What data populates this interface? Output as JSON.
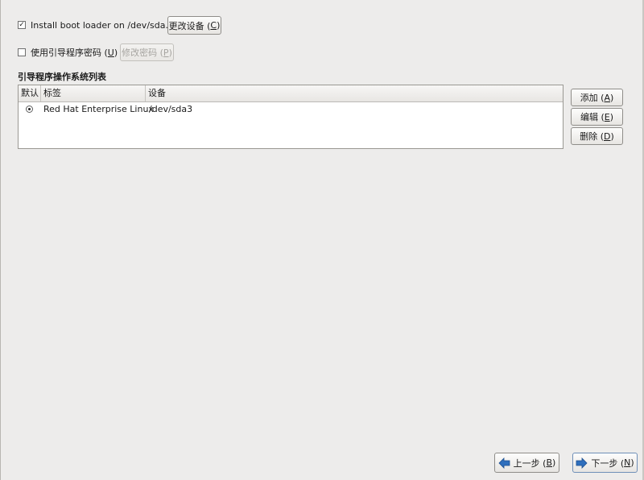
{
  "bootloader": {
    "install_label": "Install boot loader on /dev/sda.",
    "install_checked": true,
    "change_device_button": {
      "text": "更改设备 (",
      "mnemonic": "C",
      "close": ")"
    }
  },
  "password": {
    "label": "使用引导程序密码 (",
    "mnemonic": "U",
    "close": ")",
    "checked": false,
    "change_password_button": {
      "text": "修改密码 (",
      "mnemonic": "P",
      "close": ")"
    }
  },
  "os_list": {
    "title": "引导程序操作系统列表",
    "columns": [
      "默认",
      "标签",
      "设备"
    ],
    "rows": [
      {
        "default": true,
        "label": "Red Hat Enterprise Linux",
        "device": "/dev/sda3"
      }
    ]
  },
  "side_buttons": {
    "add": {
      "text": "添加 (",
      "mnemonic": "A",
      "close": ")"
    },
    "edit": {
      "text": "编辑 (",
      "mnemonic": "E",
      "close": ")"
    },
    "delete": {
      "text": "删除 (",
      "mnemonic": "D",
      "close": ")"
    }
  },
  "nav": {
    "back": {
      "text": "上一步 (",
      "mnemonic": "B",
      "close": ")"
    },
    "next": {
      "text": "下一步 (",
      "mnemonic": "N",
      "close": ")"
    }
  },
  "colors": {
    "background": "#edeceb",
    "arrow_blue": "#2f6fbd"
  }
}
